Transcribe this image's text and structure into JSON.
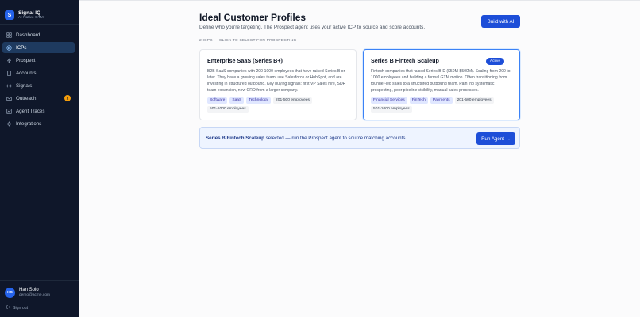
{
  "brand": {
    "logo_letter": "S",
    "title": "Signal IQ",
    "subtitle": "AI-Native GTM"
  },
  "sidebar": {
    "items": [
      {
        "label": "Dashboard",
        "icon": "grid-icon",
        "active": false
      },
      {
        "label": "ICPs",
        "icon": "target-icon",
        "active": true
      },
      {
        "label": "Prospect",
        "icon": "bolt-icon",
        "active": false
      },
      {
        "label": "Accounts",
        "icon": "building-icon",
        "active": false
      },
      {
        "label": "Signals",
        "icon": "signal-icon",
        "active": false
      },
      {
        "label": "Outreach",
        "icon": "mail-icon",
        "active": false,
        "badge": "2"
      },
      {
        "label": "Agent Traces",
        "icon": "trace-icon",
        "active": false
      },
      {
        "label": "Integrations",
        "icon": "plug-icon",
        "active": false
      }
    ]
  },
  "user": {
    "initials": "HS",
    "name": "Han Solo",
    "email": "demo@acme.com",
    "signout_label": "Sign out"
  },
  "header": {
    "title": "Ideal Customer Profiles",
    "subtitle": "Define who you're targeting. The Prospect agent uses your active ICP to source and score accounts.",
    "build_button": "Build with AI",
    "section_label": "2 ICPS — CLICK TO SELECT FOR PROSPECTING"
  },
  "icps": [
    {
      "title": "Enterprise SaaS (Series B+)",
      "description": "B2B SaaS companies with 200-1000 employees that have raised Series B or later. They have a growing sales team, use Salesforce or HubSpot, and are investing in structured outbound. Key buying signals: first VP Sales hire, SDR team expansion, new CRO from a larger company.",
      "tags_blue": [
        "Software",
        "SaaS",
        "Technology"
      ],
      "tags_gray": [
        "201-500 employees",
        "501-1000 employees"
      ]
    },
    {
      "title": "Series B Fintech Scaleup",
      "badge": "Active",
      "description": "Fintech companies that raised Series B-D ($50M-$500M). Scaling from 200 to 1000 employees and building a formal GTM motion. Often transitioning from founder-led sales to a structured outbound team. Pain: no systematic prospecting, poor pipeline visibility, manual sales processes.",
      "tags_blue": [
        "Financial Services",
        "FinTech",
        "Payments"
      ],
      "tags_gray": [
        "201-500 employees",
        "501-1000 employees"
      ]
    }
  ],
  "banner": {
    "selected_name": "Series B Fintech Scaleup",
    "text": " selected — run the Prospect agent to source matching accounts.",
    "run_button": "Run Agent →"
  },
  "colors": {
    "sidebar_bg": "#0f172a",
    "accent": "#1d4ed8",
    "badge": "#f59e0b",
    "selected_border": "#3b82f6"
  }
}
